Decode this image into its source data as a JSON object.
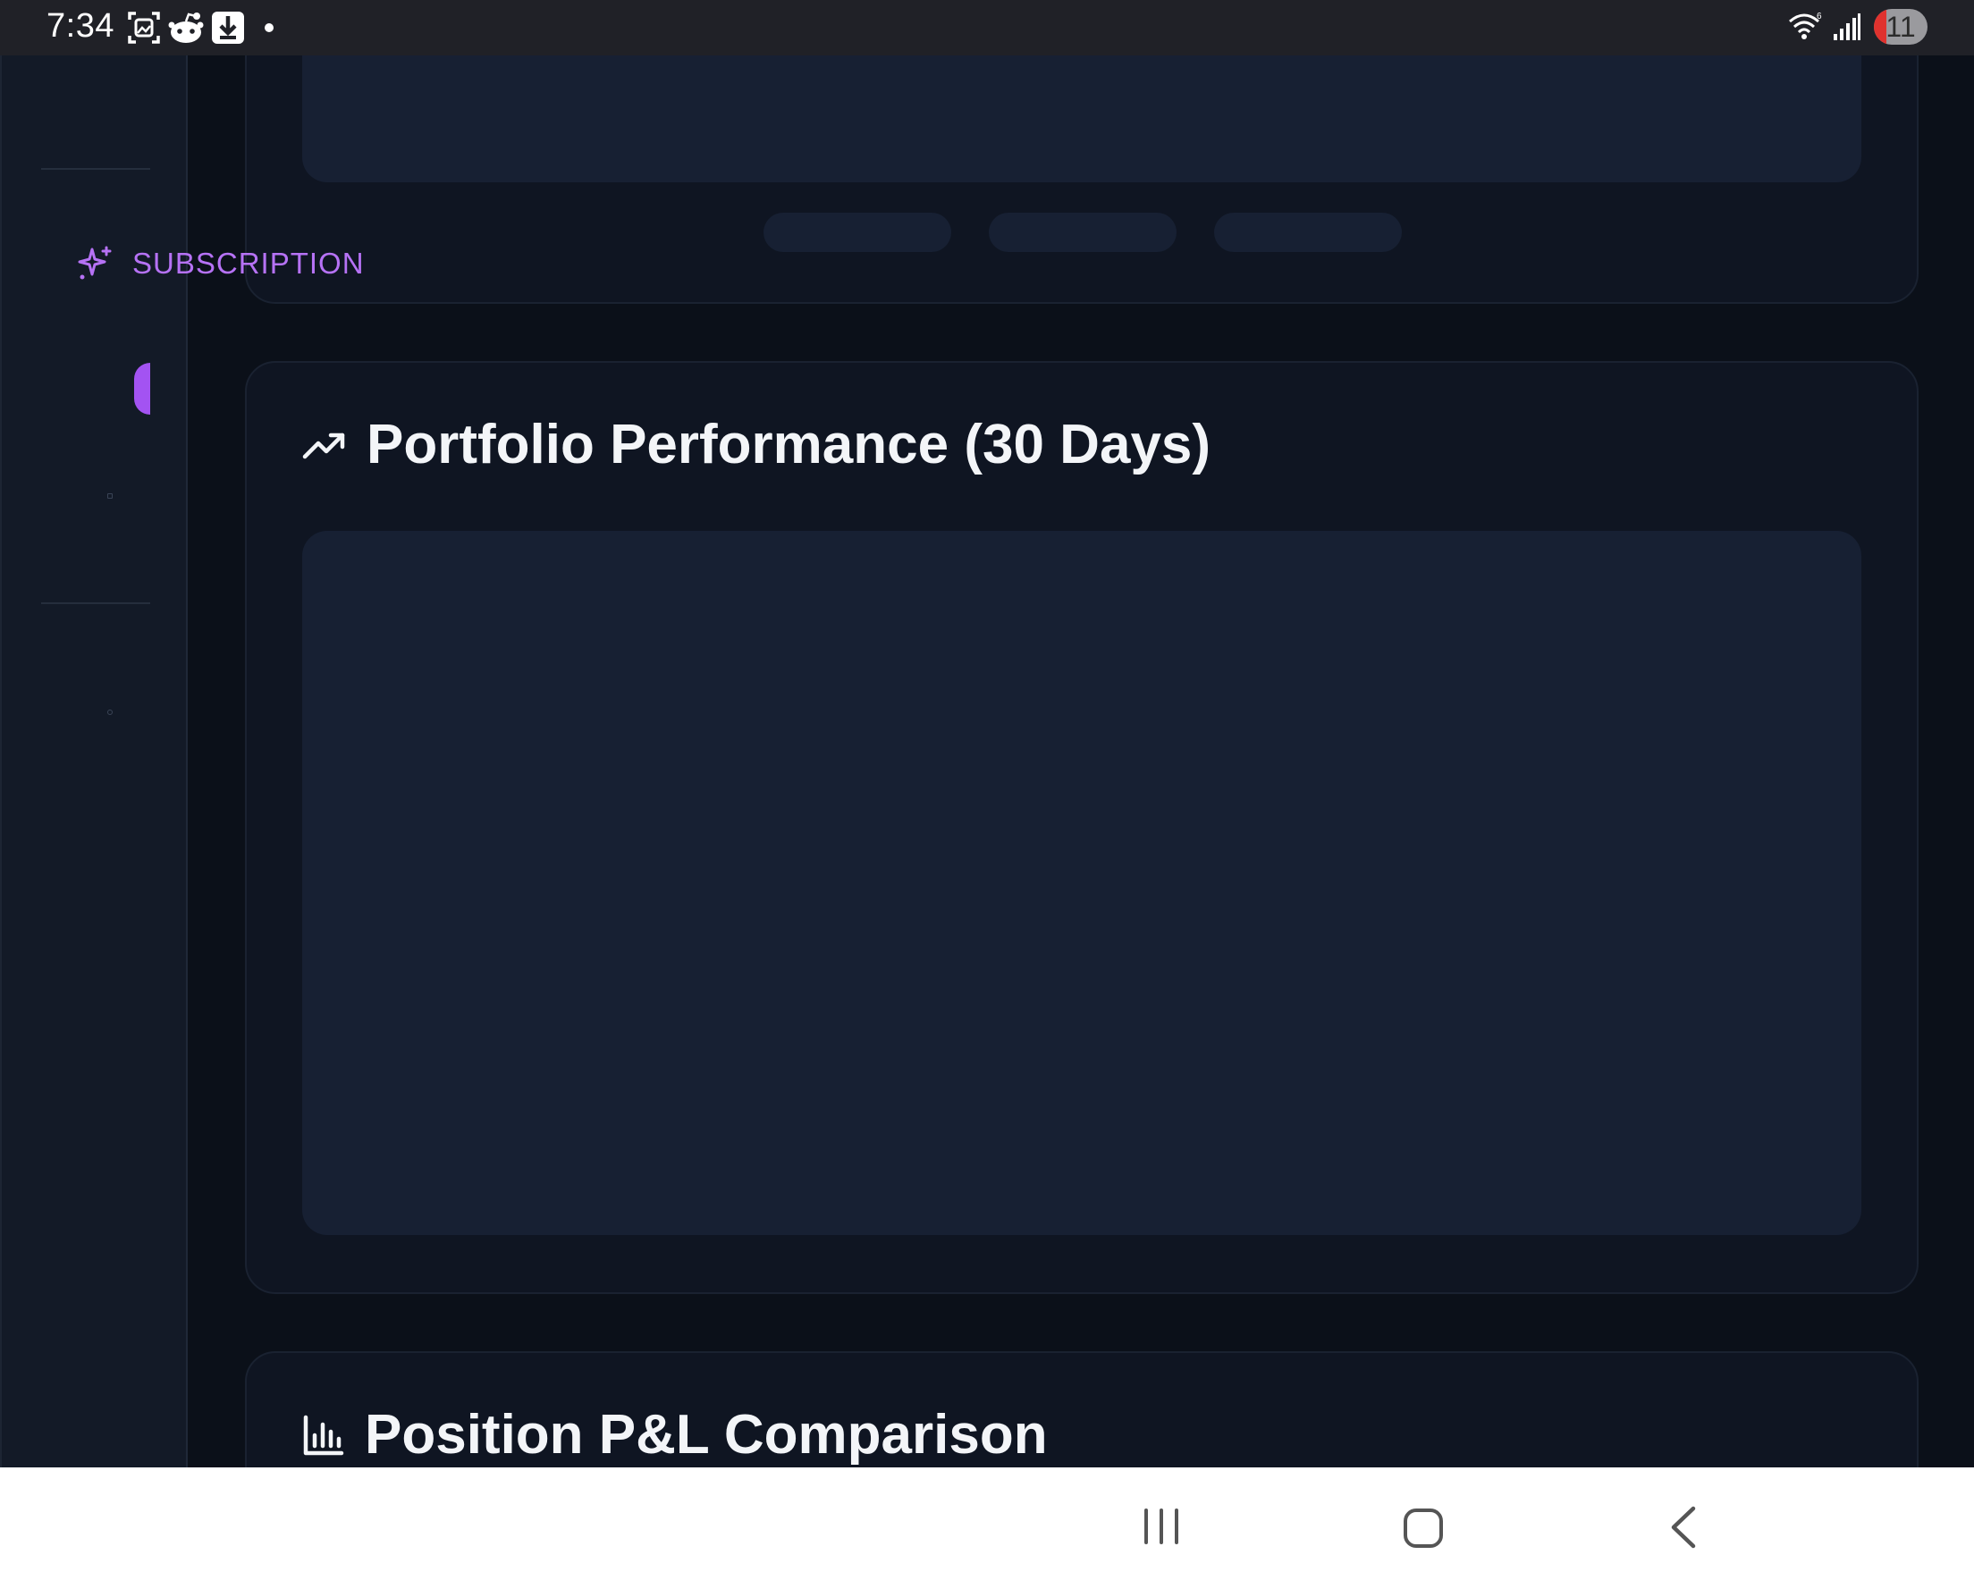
{
  "status_bar": {
    "time": "7:34",
    "icons": [
      "screenshot-icon",
      "reddit-icon",
      "download-icon",
      "notification-dot-icon",
      "wifi-icon",
      "signal-icon"
    ],
    "battery_level": "11",
    "battery_color": "#e0322e"
  },
  "sidebar": {
    "subscription_label": "SUBSCRIPTION",
    "accent_color": "#a353f2"
  },
  "cards": {
    "performance": {
      "title": "Portfolio Performance (30 Days)",
      "icon": "trending-up-icon"
    },
    "pnl": {
      "title": "Position P&L Comparison",
      "icon": "bar-chart-icon"
    }
  },
  "nav_bar": {
    "buttons": [
      "recent-apps-icon",
      "home-icon",
      "back-icon"
    ]
  }
}
